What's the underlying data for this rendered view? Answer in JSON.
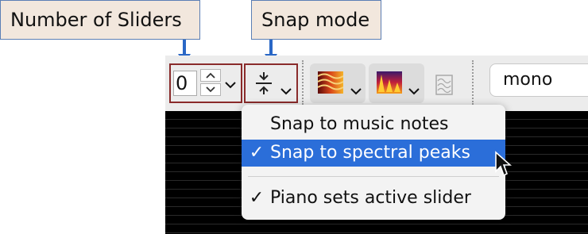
{
  "callouts": {
    "sliders": "Number of Sliders",
    "snap": "Snap mode"
  },
  "toolbar": {
    "slider_count": "0",
    "stepper_up": "^",
    "stepper_down": "v",
    "channel_value": "mono"
  },
  "snap_menu": {
    "items": [
      {
        "label": "Snap to music notes",
        "check": "",
        "highlighted": false
      },
      {
        "label": "Snap to spectral peaks",
        "check": "✓",
        "highlighted": true
      },
      {
        "label": "Piano sets active slider",
        "check": "✓",
        "highlighted": false
      }
    ]
  },
  "colors": {
    "callout_bg": "#f2e7dd",
    "callout_border": "#5b7fb5",
    "arrow": "#2a67c6",
    "highlight": "#2b6ed9",
    "box_border": "#8a2b2b"
  },
  "icons": [
    "chevron-down-icon",
    "snap-arrows-icon",
    "wave-colormap-icon",
    "flame-colormap-icon",
    "waveform-icon",
    "checkmark-icon",
    "mouse-cursor-icon"
  ]
}
